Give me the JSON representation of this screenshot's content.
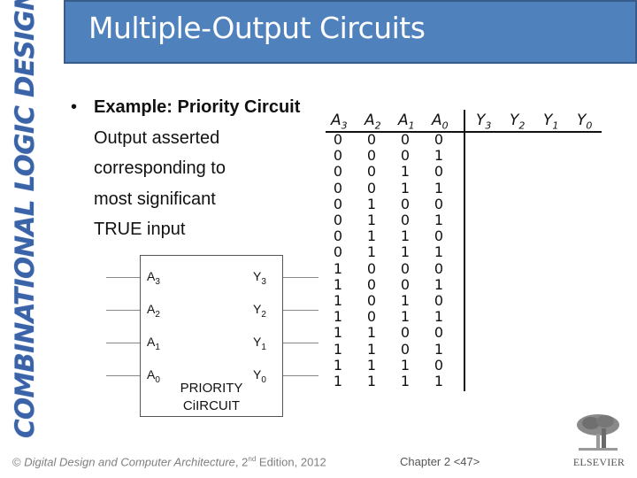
{
  "side_title": "COMBINATIONAL LOGIC DESIGN",
  "title": "Multiple-Output Circuits",
  "colors": {
    "title_bg": "#4f81bd",
    "title_border": "#385d8a",
    "side_title": "#3b63a7"
  },
  "bullet": {
    "heading": "Example: Priority Circuit",
    "lines": [
      "Output asserted",
      "corresponding to",
      "most significant",
      "TRUE input"
    ]
  },
  "truth_table": {
    "input_headers": [
      {
        "base": "A",
        "sub": "3"
      },
      {
        "base": "A",
        "sub": "2"
      },
      {
        "base": "A",
        "sub": "1"
      },
      {
        "base": "A",
        "sub": "0"
      }
    ],
    "output_headers": [
      {
        "base": "Y",
        "sub": "3"
      },
      {
        "base": "Y",
        "sub": "2"
      },
      {
        "base": "Y",
        "sub": "1"
      },
      {
        "base": "Y",
        "sub": "0"
      }
    ],
    "rows": [
      [
        "0",
        "0",
        "0",
        "0"
      ],
      [
        "0",
        "0",
        "0",
        "1"
      ],
      [
        "0",
        "0",
        "1",
        "0"
      ],
      [
        "0",
        "0",
        "1",
        "1"
      ],
      [
        "0",
        "1",
        "0",
        "0"
      ],
      [
        "0",
        "1",
        "0",
        "1"
      ],
      [
        "0",
        "1",
        "1",
        "0"
      ],
      [
        "0",
        "1",
        "1",
        "1"
      ],
      [
        "1",
        "0",
        "0",
        "0"
      ],
      [
        "1",
        "0",
        "0",
        "1"
      ],
      [
        "1",
        "0",
        "1",
        "0"
      ],
      [
        "1",
        "0",
        "1",
        "1"
      ],
      [
        "1",
        "1",
        "0",
        "0"
      ],
      [
        "1",
        "1",
        "0",
        "1"
      ],
      [
        "1",
        "1",
        "1",
        "0"
      ],
      [
        "1",
        "1",
        "1",
        "1"
      ]
    ]
  },
  "circuit": {
    "inputs": [
      {
        "base": "A",
        "sub": "3"
      },
      {
        "base": "A",
        "sub": "2"
      },
      {
        "base": "A",
        "sub": "1"
      },
      {
        "base": "A",
        "sub": "0"
      }
    ],
    "outputs": [
      {
        "base": "Y",
        "sub": "3"
      },
      {
        "base": "Y",
        "sub": "2"
      },
      {
        "base": "Y",
        "sub": "1"
      },
      {
        "base": "Y",
        "sub": "0"
      }
    ],
    "name_line1": "PRIORITY",
    "name_line2": "CiIRCUIT"
  },
  "footer": {
    "copyright_symbol": "©",
    "book_title": "Digital Design and Computer Architecture",
    "edition_num": ", 2",
    "edition_sup": "nd",
    "edition_rest": " Edition, 2012",
    "chapter": "Chapter 2 <47>",
    "publisher": "ELSEVIER"
  }
}
